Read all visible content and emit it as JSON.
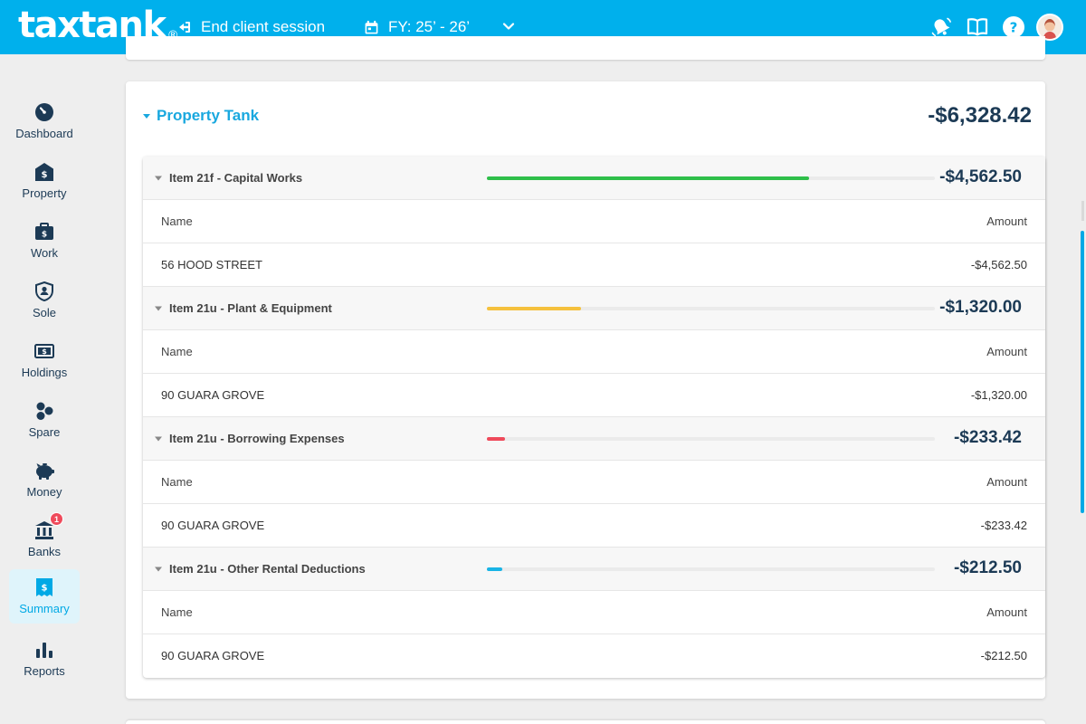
{
  "header": {
    "logo": "taxtank",
    "logo_mark": "®",
    "end_session_label": "End client session",
    "fy_label": "FY: 25’ - 26’"
  },
  "sidebar": {
    "items": [
      {
        "label": "Dashboard",
        "icon": "dashboard-gauge-icon"
      },
      {
        "label": "Property",
        "icon": "property-house-icon"
      },
      {
        "label": "Work",
        "icon": "work-briefcase-icon"
      },
      {
        "label": "Sole",
        "icon": "sole-shield-icon"
      },
      {
        "label": "Holdings",
        "icon": "holdings-money-icon"
      },
      {
        "label": "Spare",
        "icon": "spare-hexagons-icon"
      },
      {
        "label": "Money",
        "icon": "money-piggy-icon"
      },
      {
        "label": "Banks",
        "icon": "banks-building-icon",
        "badge": "1"
      },
      {
        "label": "Summary",
        "icon": "summary-receipt-icon",
        "active": true
      },
      {
        "label": "Reports",
        "icon": "reports-bar-icon"
      }
    ]
  },
  "card": {
    "title": "Property Tank",
    "total": "-$6,328.42"
  },
  "sections": [
    {
      "title": "Item 21f - Capital Works",
      "amount": "-$4,562.50",
      "bar_color": "#2fbf4a",
      "bar_fraction": 0.72,
      "col_name": "Name",
      "col_amount": "Amount",
      "row_name": "56 HOOD STREET",
      "row_amount": "-$4,562.50"
    },
    {
      "title": "Item 21u - Plant & Equipment",
      "amount": "-$1,320.00",
      "bar_color": "#f5c13d",
      "bar_fraction": 0.21,
      "col_name": "Name",
      "col_amount": "Amount",
      "row_name": "90 GUARA GROVE",
      "row_amount": "-$1,320.00"
    },
    {
      "title": "Item 21u - Borrowing Expenses",
      "amount": "-$233.42",
      "bar_color": "#ef4a5b",
      "bar_fraction": 0.04,
      "col_name": "Name",
      "col_amount": "Amount",
      "row_name": "90 GUARA GROVE",
      "row_amount": "-$233.42"
    },
    {
      "title": "Item 21u - Other Rental Deductions",
      "amount": "-$212.50",
      "bar_color": "#19b4e6",
      "bar_fraction": 0.035,
      "col_name": "Name",
      "col_amount": "Amount",
      "row_name": "90 GUARA GROVE",
      "row_amount": "-$212.50"
    }
  ],
  "colors": {
    "brand": "#00b0ec",
    "navy": "#1c3a55",
    "accent": "#19a8df"
  }
}
